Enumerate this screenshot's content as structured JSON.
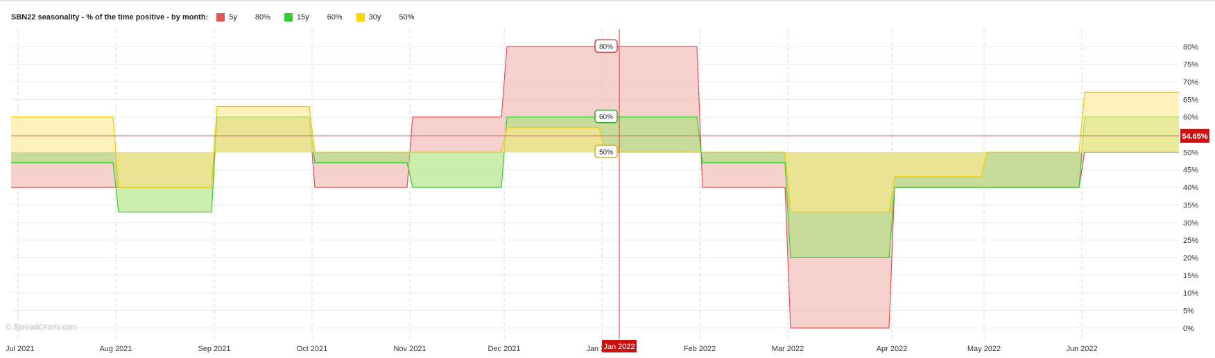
{
  "title": "SBN22 seasonality - % of the time positive - by month:",
  "legend": [
    {
      "name": "5y",
      "value": "80%",
      "color": "#e05555"
    },
    {
      "name": "15y",
      "value": "60%",
      "color": "#33cc33"
    },
    {
      "name": "30y",
      "value": "50%",
      "color": "#ffd400"
    }
  ],
  "watermark": "© SpreadCharts.com",
  "crosshair": {
    "x_label": "Jan 2022",
    "y_label": "54.65%",
    "y_value": 54.65
  },
  "chart_data": {
    "type": "area",
    "title": "SBN22 seasonality - % of the time positive - by month:",
    "ylim": [
      -3,
      85
    ],
    "y_ticks": [
      "0%",
      "5%",
      "10%",
      "15%",
      "20%",
      "25%",
      "30%",
      "35%",
      "40%",
      "45%",
      "50%",
      "55%",
      "60%",
      "65%",
      "70%",
      "75%",
      "80%"
    ],
    "x_ticks": [
      "Jul 2021",
      "Aug 2021",
      "Sep 2021",
      "Oct 2021",
      "Nov 2021",
      "Dec 2021",
      "Jan 2022",
      "Feb 2022",
      "Mar 2022",
      "Apr 2022",
      "May 2022",
      "Jun 2022"
    ],
    "baseline": 50,
    "grid": true,
    "legend_position": "top-left",
    "series": [
      {
        "name": "5y",
        "color": "#e05555",
        "fill": "#f0b3ad",
        "values": [
          40,
          40,
          60,
          40,
          60,
          80,
          80,
          40,
          0,
          40,
          40,
          50
        ],
        "point_labels": [
          "",
          "",
          "",
          "",
          "",
          "",
          "80%",
          "",
          "",
          "",
          "",
          ""
        ]
      },
      {
        "name": "15y",
        "color": "#33cc33",
        "fill": "#a9e27a",
        "values": [
          47,
          33,
          60,
          47,
          40,
          60,
          60,
          47,
          20,
          40,
          40,
          60
        ],
        "point_labels": [
          "",
          "",
          "",
          "",
          "",
          "",
          "60%",
          "",
          "",
          "",
          "",
          ""
        ]
      },
      {
        "name": "30y",
        "color": "#f2cc00",
        "fill": "#ffe88d",
        "values": [
          60,
          40,
          63,
          50,
          50,
          57,
          50,
          50,
          33,
          43,
          50,
          67
        ],
        "point_labels": [
          "",
          "",
          "",
          "",
          "",
          "",
          "50%",
          "",
          "",
          "",
          "",
          ""
        ]
      }
    ]
  }
}
